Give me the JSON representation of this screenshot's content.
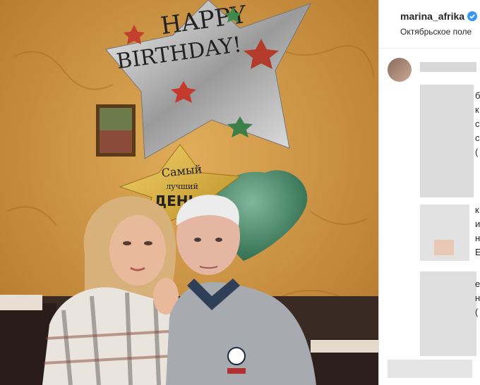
{
  "post": {
    "username": "marina_afrika",
    "location": "Октябрьское поле",
    "verified": true
  },
  "photo": {
    "balloon_text_top": "HAPPY BIRTHDAY!",
    "balloon_text_gold_1": "Самый",
    "balloon_text_gold_2": "лучший",
    "balloon_text_gold_3": "ДЕНЬ"
  },
  "comment_fragments": [
    "б",
    "к",
    "с",
    "с",
    "(",
    "к",
    "и",
    "н",
    "Е",
    "е",
    "н",
    "("
  ],
  "colors": {
    "wall": "#c8913c",
    "verified_badge": "#3897f0",
    "balloon_green": "#3f7d5e",
    "balloon_gold": "#d9b13a"
  }
}
